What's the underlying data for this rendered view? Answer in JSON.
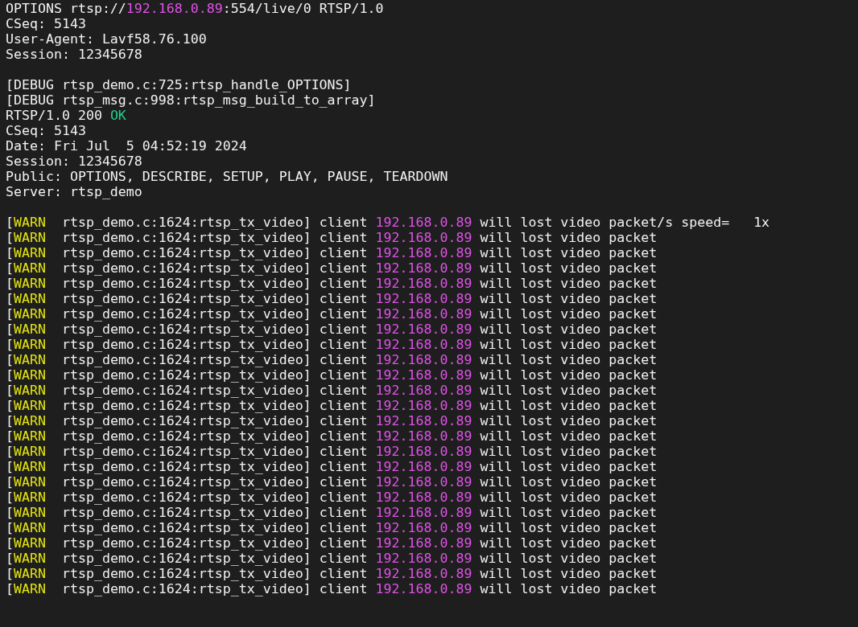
{
  "terminal": {
    "blocks": [
      {
        "lines": [
          {
            "segments": [
              {
                "text": "OPTIONS rtsp://",
                "kind": "plain"
              },
              {
                "text": "192.168.0.89",
                "kind": "ip"
              },
              {
                "text": ":554/live/0 RTSP/1.0",
                "kind": "plain"
              }
            ]
          },
          {
            "segments": [
              {
                "text": "CSeq: 5143",
                "kind": "plain"
              }
            ]
          },
          {
            "segments": [
              {
                "text": "User-Agent: Lavf58.76.100",
                "kind": "plain"
              }
            ]
          },
          {
            "segments": [
              {
                "text": "Session: 12345678",
                "kind": "plain"
              }
            ]
          }
        ]
      },
      {
        "lines": [
          {
            "segments": [
              {
                "text": "[DEBUG rtsp_demo.c:725:rtsp_handle_OPTIONS]",
                "kind": "plain"
              }
            ]
          },
          {
            "segments": [
              {
                "text": "[DEBUG rtsp_msg.c:998:rtsp_msg_build_to_array]",
                "kind": "plain"
              }
            ]
          },
          {
            "segments": [
              {
                "text": "RTSP/1.0 200 ",
                "kind": "plain"
              },
              {
                "text": "OK",
                "kind": "ok"
              }
            ]
          },
          {
            "segments": [
              {
                "text": "CSeq: 5143",
                "kind": "plain"
              }
            ]
          },
          {
            "segments": [
              {
                "text": "Date: Fri Jul  5 04:52:19 2024",
                "kind": "plain"
              }
            ]
          },
          {
            "segments": [
              {
                "text": "Session: 12345678",
                "kind": "plain"
              }
            ]
          },
          {
            "segments": [
              {
                "text": "Public: OPTIONS, DESCRIBE, SETUP, PLAY, PAUSE, TEARDOWN",
                "kind": "plain"
              }
            ]
          },
          {
            "segments": [
              {
                "text": "Server: rtsp_demo",
                "kind": "plain"
              }
            ]
          }
        ]
      },
      {
        "lines": [
          {
            "segments": [
              {
                "text": "[",
                "kind": "plain"
              },
              {
                "text": "WARN",
                "kind": "warn"
              },
              {
                "text": "  rtsp_demo.c:1624:rtsp_tx_video] client ",
                "kind": "plain"
              },
              {
                "text": "192.168.0.89",
                "kind": "ip"
              },
              {
                "text": " will lost video packet/s speed=   1x",
                "kind": "plain"
              }
            ]
          },
          {
            "segments": [
              {
                "text": "[",
                "kind": "plain"
              },
              {
                "text": "WARN",
                "kind": "warn"
              },
              {
                "text": "  rtsp_demo.c:1624:rtsp_tx_video] client ",
                "kind": "plain"
              },
              {
                "text": "192.168.0.89",
                "kind": "ip"
              },
              {
                "text": " will lost video packet",
                "kind": "plain"
              }
            ]
          },
          {
            "segments": [
              {
                "text": "[",
                "kind": "plain"
              },
              {
                "text": "WARN",
                "kind": "warn"
              },
              {
                "text": "  rtsp_demo.c:1624:rtsp_tx_video] client ",
                "kind": "plain"
              },
              {
                "text": "192.168.0.89",
                "kind": "ip"
              },
              {
                "text": " will lost video packet",
                "kind": "plain"
              }
            ]
          },
          {
            "segments": [
              {
                "text": "[",
                "kind": "plain"
              },
              {
                "text": "WARN",
                "kind": "warn"
              },
              {
                "text": "  rtsp_demo.c:1624:rtsp_tx_video] client ",
                "kind": "plain"
              },
              {
                "text": "192.168.0.89",
                "kind": "ip"
              },
              {
                "text": " will lost video packet",
                "kind": "plain"
              }
            ]
          },
          {
            "segments": [
              {
                "text": "[",
                "kind": "plain"
              },
              {
                "text": "WARN",
                "kind": "warn"
              },
              {
                "text": "  rtsp_demo.c:1624:rtsp_tx_video] client ",
                "kind": "plain"
              },
              {
                "text": "192.168.0.89",
                "kind": "ip"
              },
              {
                "text": " will lost video packet",
                "kind": "plain"
              }
            ]
          },
          {
            "segments": [
              {
                "text": "[",
                "kind": "plain"
              },
              {
                "text": "WARN",
                "kind": "warn"
              },
              {
                "text": "  rtsp_demo.c:1624:rtsp_tx_video] client ",
                "kind": "plain"
              },
              {
                "text": "192.168.0.89",
                "kind": "ip"
              },
              {
                "text": " will lost video packet",
                "kind": "plain"
              }
            ]
          },
          {
            "segments": [
              {
                "text": "[",
                "kind": "plain"
              },
              {
                "text": "WARN",
                "kind": "warn"
              },
              {
                "text": "  rtsp_demo.c:1624:rtsp_tx_video] client ",
                "kind": "plain"
              },
              {
                "text": "192.168.0.89",
                "kind": "ip"
              },
              {
                "text": " will lost video packet",
                "kind": "plain"
              }
            ]
          },
          {
            "segments": [
              {
                "text": "[",
                "kind": "plain"
              },
              {
                "text": "WARN",
                "kind": "warn"
              },
              {
                "text": "  rtsp_demo.c:1624:rtsp_tx_video] client ",
                "kind": "plain"
              },
              {
                "text": "192.168.0.89",
                "kind": "ip"
              },
              {
                "text": " will lost video packet",
                "kind": "plain"
              }
            ]
          },
          {
            "segments": [
              {
                "text": "[",
                "kind": "plain"
              },
              {
                "text": "WARN",
                "kind": "warn"
              },
              {
                "text": "  rtsp_demo.c:1624:rtsp_tx_video] client ",
                "kind": "plain"
              },
              {
                "text": "192.168.0.89",
                "kind": "ip"
              },
              {
                "text": " will lost video packet",
                "kind": "plain"
              }
            ]
          },
          {
            "segments": [
              {
                "text": "[",
                "kind": "plain"
              },
              {
                "text": "WARN",
                "kind": "warn"
              },
              {
                "text": "  rtsp_demo.c:1624:rtsp_tx_video] client ",
                "kind": "plain"
              },
              {
                "text": "192.168.0.89",
                "kind": "ip"
              },
              {
                "text": " will lost video packet",
                "kind": "plain"
              }
            ]
          },
          {
            "segments": [
              {
                "text": "[",
                "kind": "plain"
              },
              {
                "text": "WARN",
                "kind": "warn"
              },
              {
                "text": "  rtsp_demo.c:1624:rtsp_tx_video] client ",
                "kind": "plain"
              },
              {
                "text": "192.168.0.89",
                "kind": "ip"
              },
              {
                "text": " will lost video packet",
                "kind": "plain"
              }
            ]
          },
          {
            "segments": [
              {
                "text": "[",
                "kind": "plain"
              },
              {
                "text": "WARN",
                "kind": "warn"
              },
              {
                "text": "  rtsp_demo.c:1624:rtsp_tx_video] client ",
                "kind": "plain"
              },
              {
                "text": "192.168.0.89",
                "kind": "ip"
              },
              {
                "text": " will lost video packet",
                "kind": "plain"
              }
            ]
          },
          {
            "segments": [
              {
                "text": "[",
                "kind": "plain"
              },
              {
                "text": "WARN",
                "kind": "warn"
              },
              {
                "text": "  rtsp_demo.c:1624:rtsp_tx_video] client ",
                "kind": "plain"
              },
              {
                "text": "192.168.0.89",
                "kind": "ip"
              },
              {
                "text": " will lost video packet",
                "kind": "plain"
              }
            ]
          },
          {
            "segments": [
              {
                "text": "[",
                "kind": "plain"
              },
              {
                "text": "WARN",
                "kind": "warn"
              },
              {
                "text": "  rtsp_demo.c:1624:rtsp_tx_video] client ",
                "kind": "plain"
              },
              {
                "text": "192.168.0.89",
                "kind": "ip"
              },
              {
                "text": " will lost video packet",
                "kind": "plain"
              }
            ]
          },
          {
            "segments": [
              {
                "text": "[",
                "kind": "plain"
              },
              {
                "text": "WARN",
                "kind": "warn"
              },
              {
                "text": "  rtsp_demo.c:1624:rtsp_tx_video] client ",
                "kind": "plain"
              },
              {
                "text": "192.168.0.89",
                "kind": "ip"
              },
              {
                "text": " will lost video packet",
                "kind": "plain"
              }
            ]
          },
          {
            "segments": [
              {
                "text": "[",
                "kind": "plain"
              },
              {
                "text": "WARN",
                "kind": "warn"
              },
              {
                "text": "  rtsp_demo.c:1624:rtsp_tx_video] client ",
                "kind": "plain"
              },
              {
                "text": "192.168.0.89",
                "kind": "ip"
              },
              {
                "text": " will lost video packet",
                "kind": "plain"
              }
            ]
          },
          {
            "segments": [
              {
                "text": "[",
                "kind": "plain"
              },
              {
                "text": "WARN",
                "kind": "warn"
              },
              {
                "text": "  rtsp_demo.c:1624:rtsp_tx_video] client ",
                "kind": "plain"
              },
              {
                "text": "192.168.0.89",
                "kind": "ip"
              },
              {
                "text": " will lost video packet",
                "kind": "plain"
              }
            ]
          },
          {
            "segments": [
              {
                "text": "[",
                "kind": "plain"
              },
              {
                "text": "WARN",
                "kind": "warn"
              },
              {
                "text": "  rtsp_demo.c:1624:rtsp_tx_video] client ",
                "kind": "plain"
              },
              {
                "text": "192.168.0.89",
                "kind": "ip"
              },
              {
                "text": " will lost video packet",
                "kind": "plain"
              }
            ]
          },
          {
            "segments": [
              {
                "text": "[",
                "kind": "plain"
              },
              {
                "text": "WARN",
                "kind": "warn"
              },
              {
                "text": "  rtsp_demo.c:1624:rtsp_tx_video] client ",
                "kind": "plain"
              },
              {
                "text": "192.168.0.89",
                "kind": "ip"
              },
              {
                "text": " will lost video packet",
                "kind": "plain"
              }
            ]
          },
          {
            "segments": [
              {
                "text": "[",
                "kind": "plain"
              },
              {
                "text": "WARN",
                "kind": "warn"
              },
              {
                "text": "  rtsp_demo.c:1624:rtsp_tx_video] client ",
                "kind": "plain"
              },
              {
                "text": "192.168.0.89",
                "kind": "ip"
              },
              {
                "text": " will lost video packet",
                "kind": "plain"
              }
            ]
          },
          {
            "segments": [
              {
                "text": "[",
                "kind": "plain"
              },
              {
                "text": "WARN",
                "kind": "warn"
              },
              {
                "text": "  rtsp_demo.c:1624:rtsp_tx_video] client ",
                "kind": "plain"
              },
              {
                "text": "192.168.0.89",
                "kind": "ip"
              },
              {
                "text": " will lost video packet",
                "kind": "plain"
              }
            ]
          },
          {
            "segments": [
              {
                "text": "[",
                "kind": "plain"
              },
              {
                "text": "WARN",
                "kind": "warn"
              },
              {
                "text": "  rtsp_demo.c:1624:rtsp_tx_video] client ",
                "kind": "plain"
              },
              {
                "text": "192.168.0.89",
                "kind": "ip"
              },
              {
                "text": " will lost video packet",
                "kind": "plain"
              }
            ]
          },
          {
            "segments": [
              {
                "text": "[",
                "kind": "plain"
              },
              {
                "text": "WARN",
                "kind": "warn"
              },
              {
                "text": "  rtsp_demo.c:1624:rtsp_tx_video] client ",
                "kind": "plain"
              },
              {
                "text": "192.168.0.89",
                "kind": "ip"
              },
              {
                "text": " will lost video packet",
                "kind": "plain"
              }
            ]
          },
          {
            "segments": [
              {
                "text": "[",
                "kind": "plain"
              },
              {
                "text": "WARN",
                "kind": "warn"
              },
              {
                "text": "  rtsp_demo.c:1624:rtsp_tx_video] client ",
                "kind": "plain"
              },
              {
                "text": "192.168.0.89",
                "kind": "ip"
              },
              {
                "text": " will lost video packet",
                "kind": "plain"
              }
            ]
          },
          {
            "segments": [
              {
                "text": "[",
                "kind": "plain"
              },
              {
                "text": "WARN",
                "kind": "warn"
              },
              {
                "text": "  rtsp_demo.c:1624:rtsp_tx_video] client ",
                "kind": "plain"
              },
              {
                "text": "192.168.0.89",
                "kind": "ip"
              },
              {
                "text": " will lost video packet",
                "kind": "plain"
              }
            ]
          }
        ]
      }
    ]
  }
}
